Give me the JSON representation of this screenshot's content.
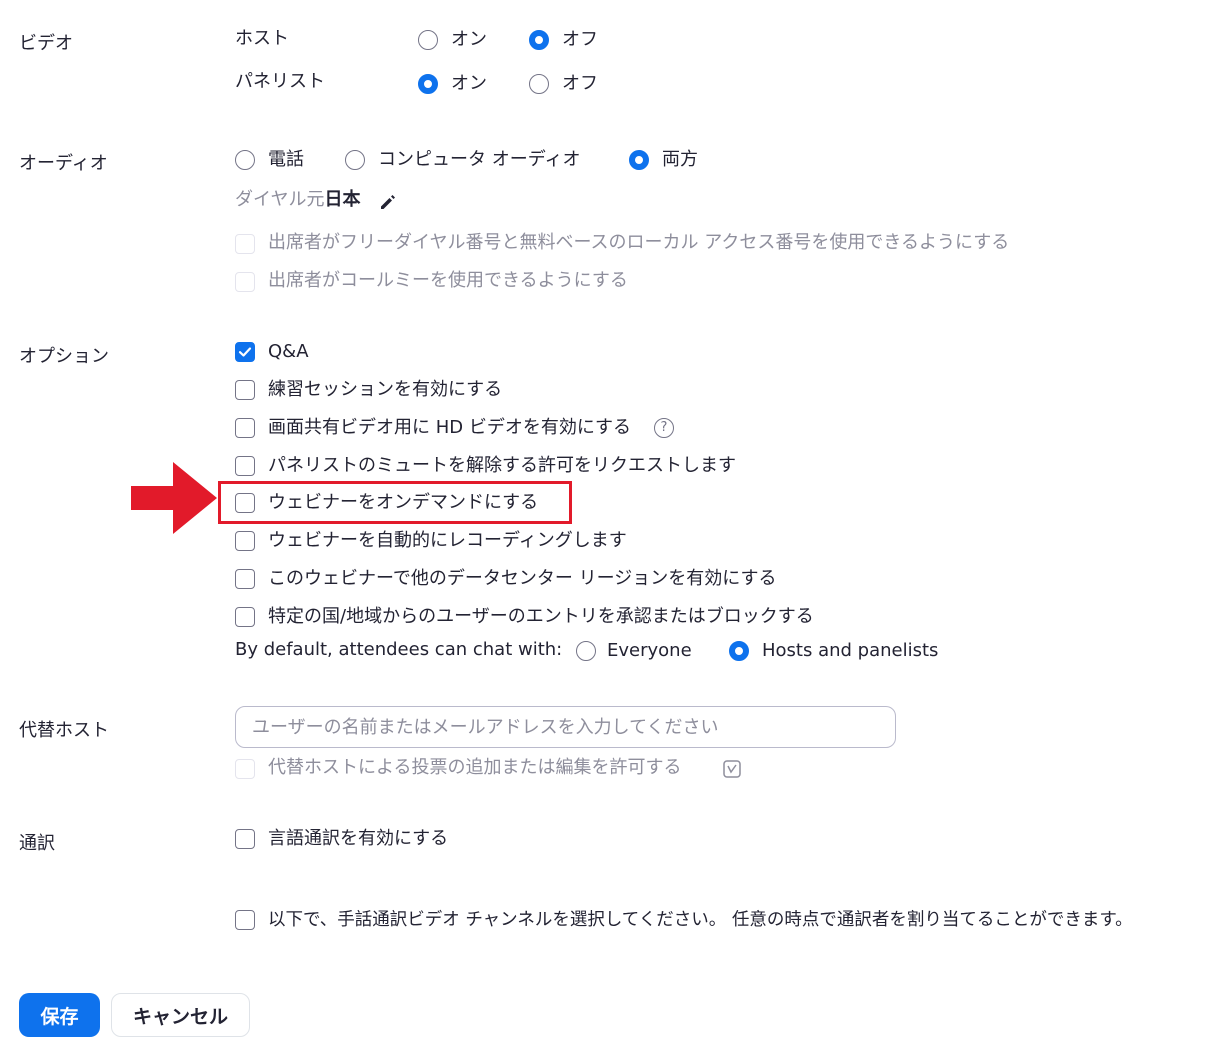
{
  "video": {
    "label": "ビデオ",
    "host_label": "ホスト",
    "panelist_label": "パネリスト",
    "on": "オン",
    "off": "オフ",
    "host_value": "オフ",
    "panelist_value": "オン"
  },
  "audio": {
    "label": "オーディオ",
    "options": [
      "電話",
      "コンピュータ オーディオ",
      "両方"
    ],
    "selected": "両方",
    "dial_prefix": "ダイヤル元",
    "dial_country": "日本",
    "toll_free": "出席者がフリーダイヤル番号と無料ベースのローカル アクセス番号を使用できるようにする",
    "call_me": "出席者がコールミーを使用できるようにする"
  },
  "options": {
    "label": "オプション",
    "items": [
      {
        "label": "Q&A",
        "checked": true
      },
      {
        "label": "練習セッションを有効にする",
        "checked": false
      },
      {
        "label": "画面共有ビデオ用に HD ビデオを有効にする",
        "checked": false
      },
      {
        "label": "パネリストのミュートを解除する許可をリクエストします",
        "checked": false
      },
      {
        "label": "ウェビナーをオンデマンドにする",
        "checked": false
      },
      {
        "label": "ウェビナーを自動的にレコーディングします",
        "checked": false
      },
      {
        "label": "このウェビナーで他のデータセンター リージョンを有効にする",
        "checked": false
      },
      {
        "label": "特定の国/地域からのユーザーのエントリを承認またはブロックする",
        "checked": false
      }
    ],
    "chat_label": "By default, attendees can chat with:",
    "chat_options": [
      "Everyone",
      "Hosts and panelists"
    ],
    "chat_selected": "Hosts and panelists",
    "help_glyph": "?"
  },
  "alt_host": {
    "label": "代替ホスト",
    "placeholder": "ユーザーの名前またはメールアドレスを入力してください",
    "polls_label": "代替ホストによる投票の追加または編集を許可する"
  },
  "interpretation": {
    "label": "通訳",
    "language": "言語通訳を有効にする",
    "sign_language": "以下で、手話通訳ビデオ チャンネルを選択してください。 任意の時点で通訳者を割り当てることができます。"
  },
  "buttons": {
    "save": "保存",
    "cancel": "キャンセル"
  },
  "annotation": {
    "arrow_color": "#e21a2a",
    "highlight_color": "#e21a2a"
  },
  "colors": {
    "accent": "#0e72ed",
    "text": "#232333",
    "disabled": "#8e8e9c"
  },
  "icons": {
    "edit": "pencil-icon",
    "help": "question-circle-icon",
    "poll": "poll-icon",
    "annotation": "red-arrow"
  }
}
